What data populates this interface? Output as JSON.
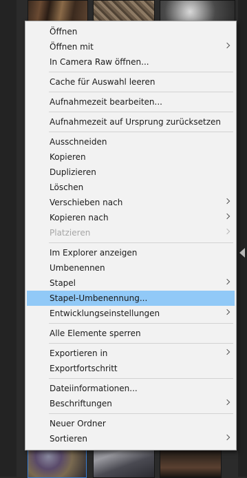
{
  "menu": {
    "items": [
      {
        "label": "Öffnen"
      },
      {
        "label": "Öffnen mit"
      },
      {
        "label": "In Camera Raw öffnen..."
      },
      {
        "label": "Cache für Auswahl leeren"
      },
      {
        "label": "Aufnahmezeit bearbeiten..."
      },
      {
        "label": "Aufnahmezeit auf Ursprung zurücksetzen"
      },
      {
        "label": "Ausschneiden"
      },
      {
        "label": "Kopieren"
      },
      {
        "label": "Duplizieren"
      },
      {
        "label": "Löschen"
      },
      {
        "label": "Verschieben nach"
      },
      {
        "label": "Kopieren nach"
      },
      {
        "label": "Platzieren"
      },
      {
        "label": "Im Explorer anzeigen"
      },
      {
        "label": "Umbenennen"
      },
      {
        "label": "Stapel"
      },
      {
        "label": "Stapel-Umbenennung..."
      },
      {
        "label": "Entwicklungseinstellungen"
      },
      {
        "label": "Alle Elemente sperren"
      },
      {
        "label": "Exportieren in"
      },
      {
        "label": "Exportfortschritt"
      },
      {
        "label": "Dateiinformationen..."
      },
      {
        "label": "Beschriftungen"
      },
      {
        "label": "Neuer Ordner"
      },
      {
        "label": "Sortieren"
      }
    ],
    "submenu_items": [
      "Öffnen mit",
      "Verschieben nach",
      "Kopieren nach",
      "Platzieren",
      "Stapel",
      "Entwicklungseinstellungen",
      "Exportieren in",
      "Beschriftungen",
      "Sortieren"
    ],
    "disabled_items": [
      "Platzieren"
    ],
    "highlighted_item": "Stapel-Umbenennung...",
    "highlight_color": "#91c9f7"
  },
  "colors": {
    "menu_background": "#f2f2f2",
    "app_background": "#2b2b2b",
    "selection_border": "#3a7fd4"
  }
}
